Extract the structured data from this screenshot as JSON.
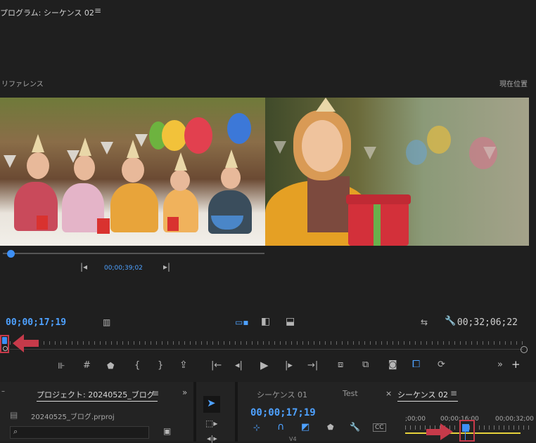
{
  "monitor": {
    "title": "プログラム: シーケンス 02",
    "menu_icon": "hamburger-menu-icon",
    "reference_label": "リファレンス",
    "current_label": "現在位置",
    "reference_timecode": "00;00;39;02",
    "current_timecode": "00;00;17;19",
    "duration_timecode": "00;32;06;22"
  },
  "project_panel": {
    "tab_title": "プロジェクト: 20240525_ブログ",
    "file_name": "20240525_ブログ.prproj",
    "search_placeholder": ""
  },
  "sequence_panel": {
    "tabs": [
      "シーケンス 01",
      "Test",
      "シーケンス 02"
    ],
    "close_symbol": "×",
    "timecode": "00;00;17;19",
    "ruler_labels": [
      ";00;00",
      "00;00;16;00",
      "00;00;32;00"
    ],
    "track_label": "V4"
  },
  "colors": {
    "accent": "#4ea1ff",
    "highlight_red": "#c63a4a",
    "in_out_yellow": "#e6d23b"
  }
}
